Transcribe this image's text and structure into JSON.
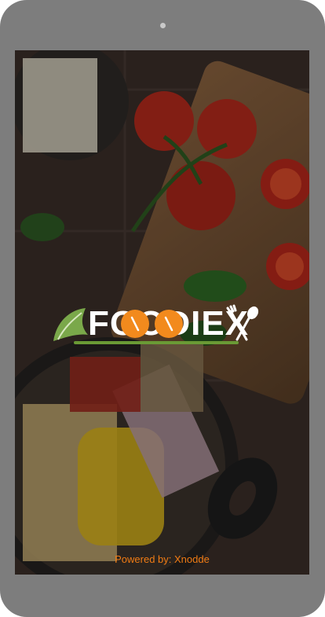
{
  "app": {
    "logo_text": "FOODIEX",
    "powered_by": "Powered by: Xnodde"
  },
  "icons": {
    "logo": "foodiex-logo-icon",
    "fork_spoon": "fork-spoon-icon",
    "camera": "front-camera-icon"
  },
  "colors": {
    "accent": "#f07b14",
    "device_frame": "#7d7d7d"
  }
}
